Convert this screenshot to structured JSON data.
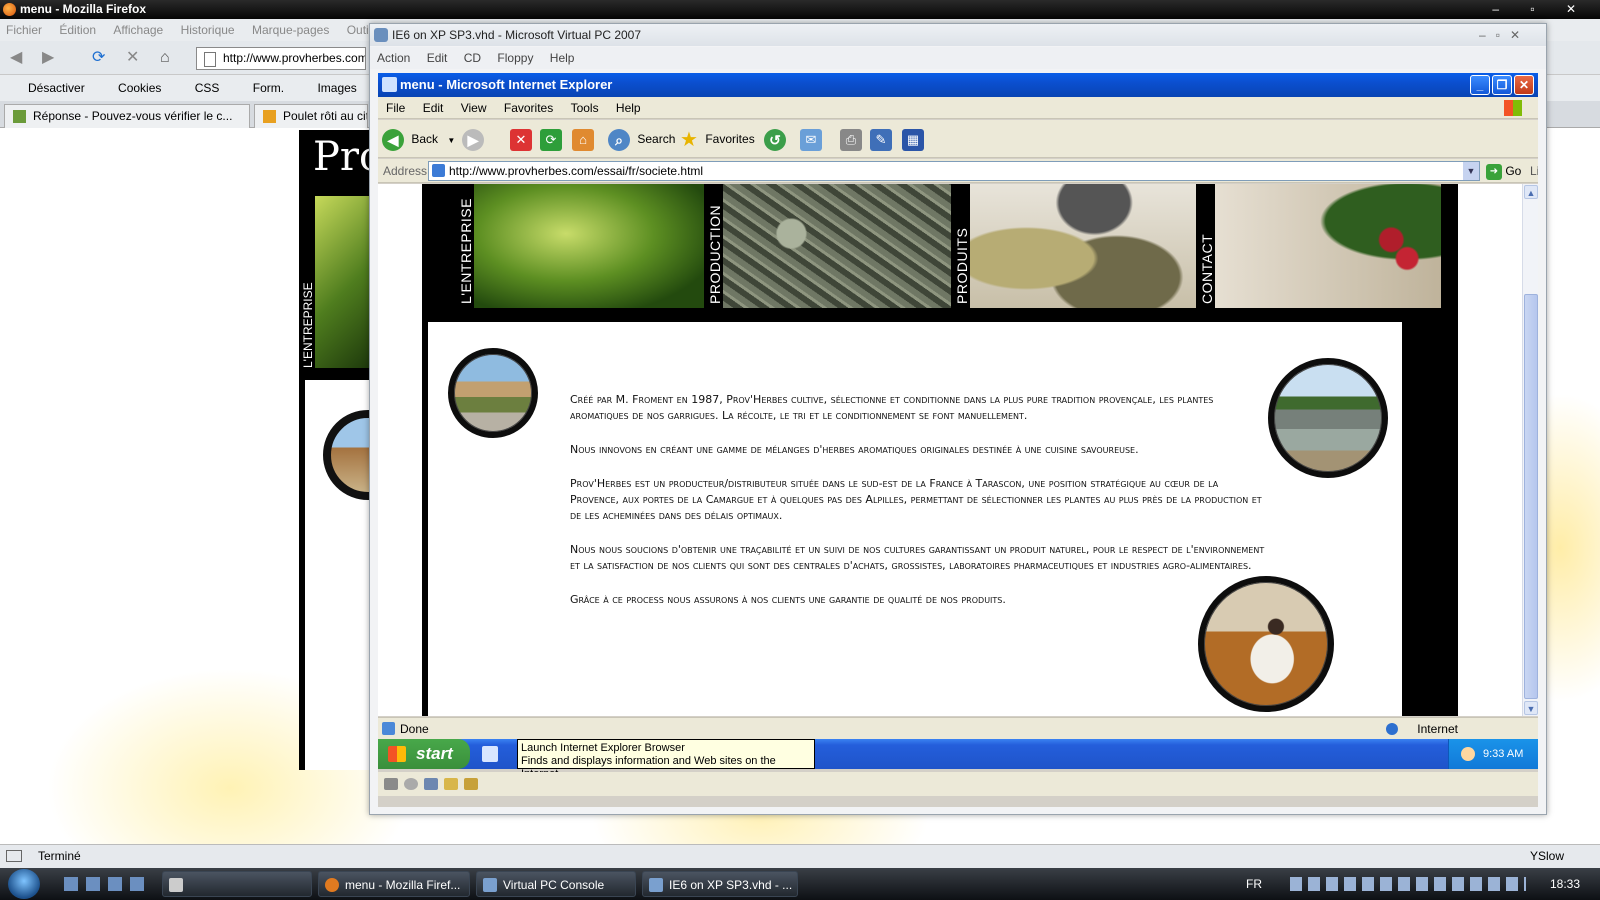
{
  "firefox": {
    "title": "menu - Mozilla Firefox",
    "window_controls": "– ▫ ✕",
    "menu": [
      "Fichier",
      "Édition",
      "Affichage",
      "Historique",
      "Marque-pages",
      "Outils"
    ],
    "url": "http://www.provherbes.com",
    "bookmarks": [
      "Désactiver",
      "Cookies",
      "CSS",
      "Form.",
      "Images"
    ],
    "tabs": [
      "Réponse - Pouvez-vous vérifier le c...",
      "Poulet rôti au cit"
    ],
    "page_logo": "Prov",
    "page_nav_label": "L'ENTREPRISE",
    "status": "Terminé",
    "status_right": "YSlow"
  },
  "vista_taskbar": {
    "buttons": [
      "menu - Mozilla Firef...",
      "Virtual PC Console",
      "IE6 on XP SP3.vhd - ..."
    ],
    "language": "FR",
    "clock": "18:33"
  },
  "vpc": {
    "title": "IE6 on XP SP3.vhd - Microsoft Virtual PC 2007",
    "menu": [
      "Action",
      "Edit",
      "CD",
      "Floppy",
      "Help"
    ]
  },
  "ie": {
    "title": "menu - Microsoft Internet Explorer",
    "menu": [
      "File",
      "Edit",
      "View",
      "Favorites",
      "Tools",
      "Help"
    ],
    "toolbar": {
      "back": "Back",
      "search": "Search",
      "favorites": "Favorites"
    },
    "address_label": "Address",
    "url": "http://www.provherbes.com/essai/fr/societe.html",
    "go": "Go",
    "links": "Links",
    "status": "Done",
    "zone": "Internet"
  },
  "site": {
    "nav": [
      "L'ENTREPRISE",
      "PRODUCTION",
      "PRODUITS",
      "CONTACT"
    ],
    "paragraphs": [
      "Créé par M. Froment en 1987, Prov'Herbes cultive, sélectionne et conditionne dans la plus pure tradition provençale, les plantes aromatiques de nos garrigues. La récolte, le tri et le conditionnement se font manuellement.",
      "Nous innovons en créant une gamme de mélanges d'herbes aromatiques originales destinée à une cuisine savoureuse.",
      "Prov'Herbes est un producteur/distributeur située dans le sud-est de la France à Tarascon, une position stratégique au cœur de la Provence, aux portes de la Camargue et à quelques pas des Alpilles, permettant de sélectionner les plantes au plus près de la production et de les acheminées dans des délais optimaux.",
      "Nous nous soucions d'obtenir une traçabilité et un suivi de nos cultures garantissant un produit naturel, pour le respect de l'environnement et la satisfaction de nos clients qui sont des centrales d'achats, grossistes, laboratoires pharmaceutiques et industries agro-alimentaires.",
      "Grâce à ce process nous assurons à nos clients une garantie de qualité de nos produits."
    ]
  },
  "xp": {
    "start": "start",
    "clock": "9:33 AM",
    "tooltip_line1": "Launch Internet Explorer Browser",
    "tooltip_line2": "Finds and displays information and Web sites on the Internet."
  }
}
